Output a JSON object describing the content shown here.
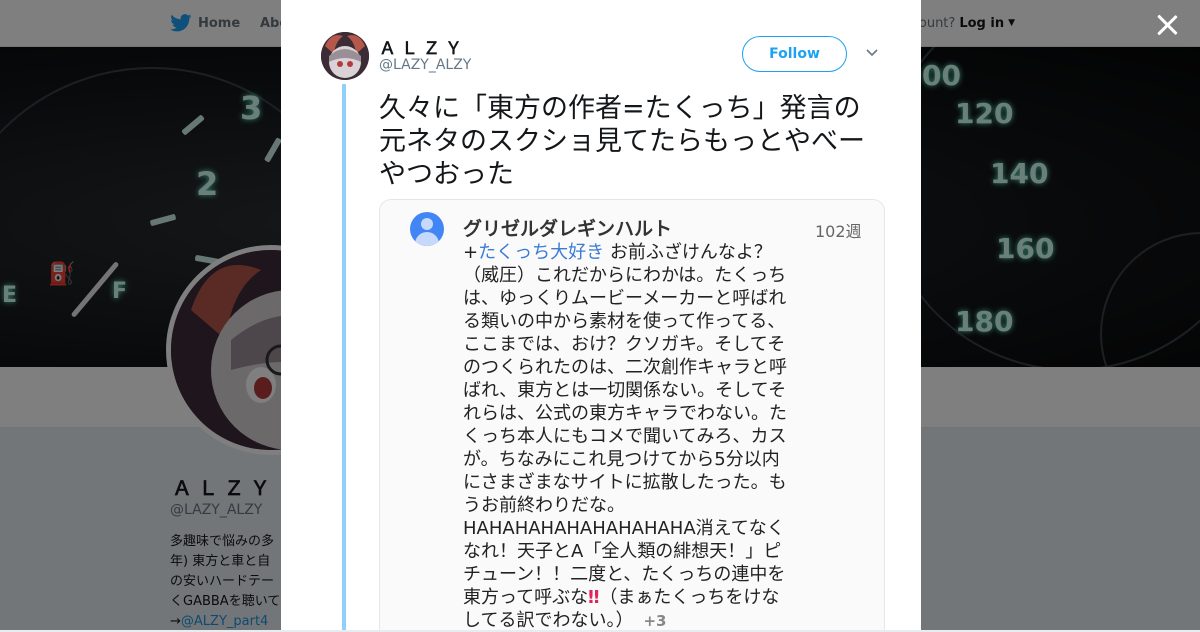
{
  "topbar": {
    "home_label": "Home",
    "about_label": "Abo",
    "account_text": "ccount?",
    "login_label": "Log in"
  },
  "banner": {
    "gauge_numbers": [
      "3",
      "2",
      "E",
      "F",
      "00",
      "120",
      "140",
      "160",
      "180"
    ]
  },
  "profile": {
    "name": "ＡＬＺＹ",
    "handle": "@LAZY_ALZY",
    "bio_lines": [
      "多趣味で悩みの多",
      "年) 東方と車と自",
      "の安いハードテー",
      "くGABBAを聴いて"
    ],
    "bio_link": "@ALZY_part4",
    "bio_link_prefix": "→"
  },
  "tweet": {
    "author_name": "ＡＬＺＹ",
    "author_handle": "@LAZY_ALZY",
    "follow_label": "Follow",
    "text": "久々に「東方の作者=たくっち」発言の元ネタのスクショ見てたらもっとやべーやつおった"
  },
  "embedded_comment": {
    "author": "グリゼルダレギンハルト",
    "time": "102週",
    "plus": "+",
    "mention": "たくっち大好き",
    "body_part1": " お前ふざけんなよ？（威圧）これだからにわかは。たくっちは、ゆっくりムービーメーカーと呼ばれる類いの中から素材を使って作ってる、ここまでは、おけ？クソガキ。そしてそのつくられたのは、二次創作キャラと呼ばれ、東方とは一切関係ない。そしてそれらは、公式の東方キャラでわない。たくっち本人にもコメで聞いてみろ、カスが。ちなみにこれ見つけてから5分以内にさまざまなサイトに拡散したった。もうお前終わりだな。HAHAHAHAHAHAHAHAHA消えてなくなれ！天子とA「全人類の緋想天！」ピチューン！！二度と、たくっちの連中を東方って呼ぶな",
    "bang": "‼",
    "body_part2": "（まぁたくっちをけなしてる訳でわない。）",
    "more": "+3"
  },
  "colors": {
    "accent": "#1da1f2",
    "thread_line": "#8ed0f9",
    "mention": "#3a7bd5"
  }
}
